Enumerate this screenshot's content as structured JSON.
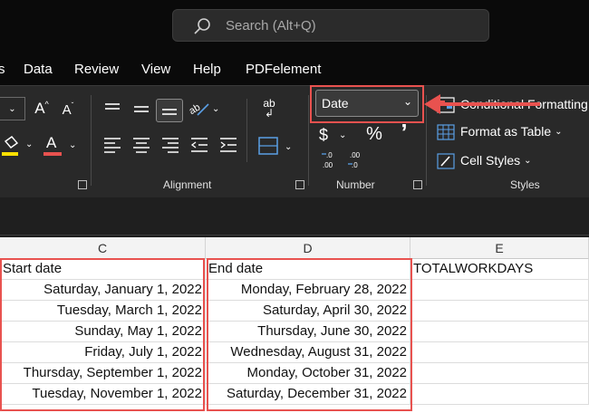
{
  "search": {
    "placeholder": "Search (Alt+Q)"
  },
  "menu": [
    "s",
    "Data",
    "Review",
    "View",
    "Help",
    "PDFelement"
  ],
  "ribbon": {
    "font": {
      "grow_label": "A",
      "shrink_label": "A",
      "color_label": "A"
    },
    "alignment": {
      "group_label": "Alignment",
      "wrap_label": "ab"
    },
    "number": {
      "group_label": "Number",
      "format_value": "Date",
      "currency": "$",
      "percent": "%",
      "comma": "’",
      "inc_decimal": ".00",
      "dec_decimal": ".00"
    },
    "styles": {
      "group_label": "Styles",
      "conditional": "Conditional Formatting",
      "format_table": "Format as Table",
      "cell_styles": "Cell Styles"
    }
  },
  "sheet": {
    "columns": [
      "C",
      "D",
      "E"
    ],
    "rows": [
      [
        "Start date",
        "End date",
        "TOTALWORKDAYS"
      ],
      [
        "Saturday, January 1, 2022",
        "Monday, February 28, 2022",
        ""
      ],
      [
        "Tuesday, March 1, 2022",
        "Saturday, April 30, 2022",
        ""
      ],
      [
        "Sunday, May 1, 2022",
        "Thursday, June 30, 2022",
        ""
      ],
      [
        "Friday, July 1, 2022",
        "Wednesday, August 31, 2022",
        ""
      ],
      [
        "Thursday, September 1, 2022",
        "Monday, October 31, 2022",
        ""
      ],
      [
        "Tuesday, November 1, 2022",
        "Saturday, December 31, 2022",
        ""
      ]
    ]
  },
  "colors": {
    "highlight": "#e8524f",
    "font_color_bar": "#e8524f",
    "fill_color_bar": "#ffe000"
  }
}
